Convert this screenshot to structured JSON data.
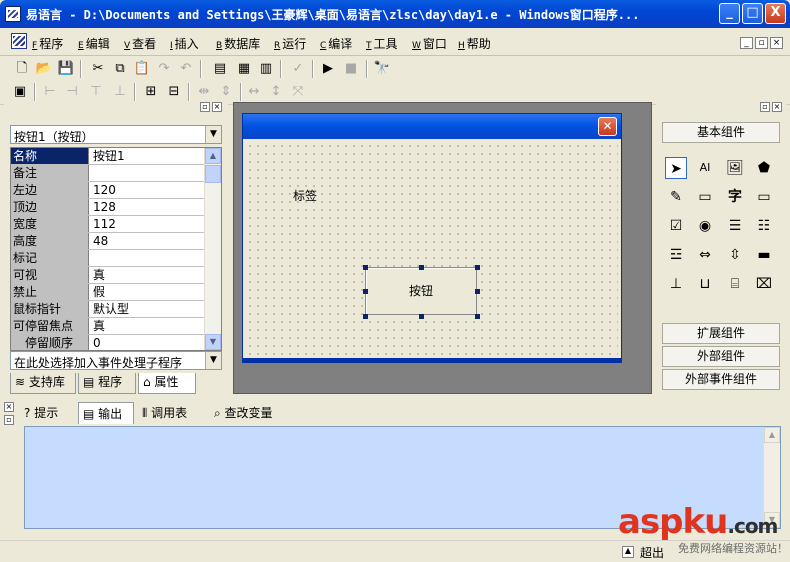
{
  "window": {
    "title": "易语言 - D:\\Documents and Settings\\王豪辉\\桌面\\易语言\\zlsc\\day\\day1.e - Windows窗口程序...",
    "min_label": "_",
    "max_label": "□",
    "close_label": "X"
  },
  "menu": {
    "items": [
      {
        "key": "F",
        "label": "程序"
      },
      {
        "key": "E",
        "label": "编辑"
      },
      {
        "key": "V",
        "label": "查看"
      },
      {
        "key": "I",
        "label": "插入"
      },
      {
        "key": "B",
        "label": "数据库"
      },
      {
        "key": "R",
        "label": "运行"
      },
      {
        "key": "C",
        "label": "编译"
      },
      {
        "key": "T",
        "label": "工具"
      },
      {
        "key": "W",
        "label": "窗口"
      },
      {
        "key": "H",
        "label": "帮助"
      }
    ],
    "mdi_min": "_",
    "mdi_restore": "▫",
    "mdi_close": "×"
  },
  "left_panel": {
    "object_selector": "按钮1（按钮）",
    "properties": [
      {
        "name": "名称",
        "value": "按钮1",
        "selected": true
      },
      {
        "name": "备注",
        "value": ""
      },
      {
        "name": "左边",
        "value": "120"
      },
      {
        "name": "顶边",
        "value": "128"
      },
      {
        "name": "宽度",
        "value": "112"
      },
      {
        "name": "高度",
        "value": "48"
      },
      {
        "name": "标记",
        "value": ""
      },
      {
        "name": "可视",
        "value": "真"
      },
      {
        "name": "禁止",
        "value": "假"
      },
      {
        "name": "鼠标指针",
        "value": "默认型"
      },
      {
        "name": "可停留焦点",
        "value": "真"
      },
      {
        "name": "停留顺序",
        "value": "0"
      }
    ],
    "event_selector": "在此处选择加入事件处理子程序",
    "tabs": [
      {
        "label": "支持库",
        "icon": "library-icon"
      },
      {
        "label": "程序",
        "icon": "program-icon"
      },
      {
        "label": "属性",
        "icon": "properties-icon"
      }
    ]
  },
  "designer": {
    "label_text": "标签",
    "button_text": "按钮"
  },
  "right_panel": {
    "basic_group": "基本组件",
    "ext_group": "扩展组件",
    "external_group": "外部组件",
    "external_event_group": "外部事件组件",
    "components": [
      "pointer-icon",
      "label-component-icon",
      "image-component-icon",
      "shape-component-icon",
      "paint-component-icon",
      "chart-component-icon",
      "text-component-icon",
      "editbox-component-icon",
      "checkbox-component-icon",
      "radio-component-icon",
      "listbox-component-icon",
      "combobox-component-icon",
      "treeview-component-icon",
      "scrollbar-component-icon",
      "slider-component-icon",
      "progress-component-icon",
      "ruler-component-icon",
      "tabs-component-icon",
      "toolbar-component-icon",
      "statusbar-component-icon"
    ],
    "glyphs": {
      "label-component-icon": "AI",
      "text-component-icon": "字"
    }
  },
  "bottom": {
    "tabs": [
      {
        "label": "提示",
        "icon": "hint-icon"
      },
      {
        "label": "输出",
        "icon": "output-icon"
      },
      {
        "label": "调用表",
        "icon": "call-table-icon"
      },
      {
        "label": "查改变量",
        "icon": "watch-variables-icon"
      }
    ],
    "status_left": "超出"
  },
  "watermark": {
    "main_a": "asp",
    "main_b": "ku",
    "main_c": ".com",
    "sub": "免费网络编程资源站！"
  },
  "colors": {
    "titlebar": "#0046d5",
    "selected_prop": "#0a246a",
    "output_bg": "#c6dcff",
    "watermark": "#e0341e"
  }
}
